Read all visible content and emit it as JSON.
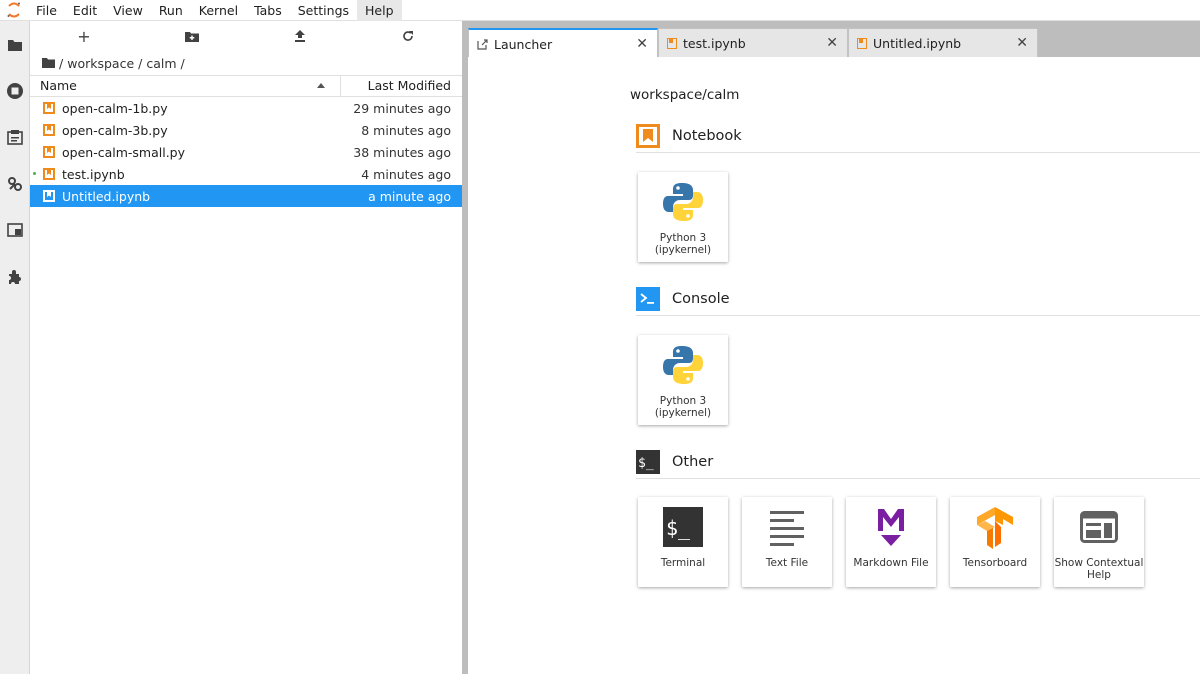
{
  "menubar": {
    "items": [
      "File",
      "Edit",
      "View",
      "Run",
      "Kernel",
      "Tabs",
      "Settings",
      "Help"
    ],
    "active": "Help"
  },
  "activity_icons": [
    "folder-icon",
    "running-icon",
    "commands-icon",
    "property-inspector-icon",
    "tabs-icon",
    "extension-icon"
  ],
  "filebrowser": {
    "breadcrumbs": [
      "/",
      "workspace",
      "/",
      "calm",
      "/"
    ],
    "columns": {
      "name": "Name",
      "modified": "Last Modified"
    },
    "files": [
      {
        "name": "open-calm-1b.py",
        "modified": "29 minutes ago"
      },
      {
        "name": "open-calm-3b.py",
        "modified": "8 minutes ago"
      },
      {
        "name": "open-calm-small.py",
        "modified": "38 minutes ago"
      },
      {
        "name": "test.ipynb",
        "modified": "4 minutes ago"
      },
      {
        "name": "Untitled.ipynb",
        "modified": "a minute ago"
      }
    ]
  },
  "tabs": [
    {
      "label": "Launcher"
    },
    {
      "label": "test.ipynb"
    },
    {
      "label": "Untitled.ipynb"
    }
  ],
  "launcher": {
    "cwd": "workspace/calm",
    "sections": {
      "notebook": "Notebook",
      "console": "Console",
      "other": "Other"
    },
    "notebook_cards": [
      {
        "line1": "Python 3",
        "line2": "(ipykernel)"
      }
    ],
    "console_cards": [
      {
        "line1": "Python 3",
        "line2": "(ipykernel)"
      }
    ],
    "other_cards": [
      {
        "line1": "Terminal",
        "line2": ""
      },
      {
        "line1": "Text File",
        "line2": ""
      },
      {
        "line1": "Markdown File",
        "line2": ""
      },
      {
        "line1": "Tensorboard",
        "line2": ""
      },
      {
        "line1": "Show Contextual",
        "line2": "Help"
      }
    ]
  },
  "colors": {
    "accent": "#2196f3",
    "notebook_orange": "#ef8b1d",
    "markdown_purple": "#7b1fa2",
    "tensorboard_orange": "#ff6f00"
  }
}
